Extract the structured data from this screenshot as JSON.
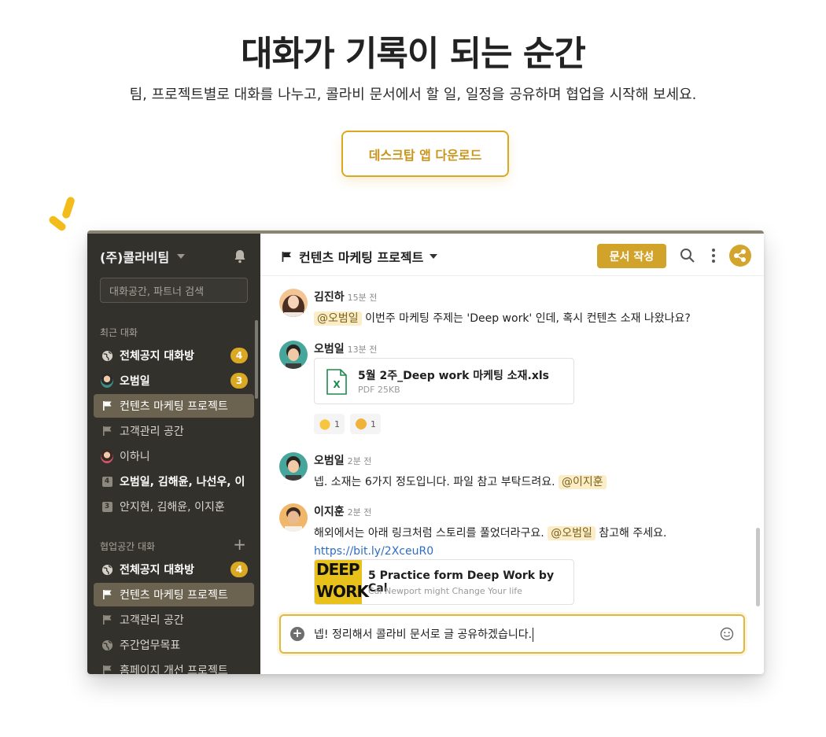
{
  "hero": {
    "title": "대화가 기록이 되는 순간",
    "subtitle": "팀, 프로젝트별로 대화를 나누고, 콜라비 문서에서 할 일, 일정을 공유하며 협업을 시작해 보세요.",
    "download_label": "데스크탑 앱 다운로드"
  },
  "colors": {
    "accent": "#dba823",
    "sidebar_bg": "#33312c",
    "mention_bg": "#fbedc6"
  },
  "sidebar": {
    "team_name": "(주)콜라비팀",
    "search_placeholder": "대화공간, 파트너 검색",
    "recent_label": "최근 대화",
    "recent": [
      {
        "icon": "globe-icon",
        "label": "전체공지 대화방",
        "badge": "4",
        "bold": true
      },
      {
        "icon": "avatar",
        "label": "오범일",
        "badge": "3",
        "bold": true
      },
      {
        "icon": "flag-icon",
        "label": "컨텐츠 마케팅 프로젝트",
        "active": true
      },
      {
        "icon": "flag-icon",
        "label": "고객관리 공간"
      },
      {
        "icon": "avatar",
        "label": "이하니"
      },
      {
        "icon": "group-count-icon",
        "count": "4",
        "label": "오범일, 김해윤, 나선우, 이",
        "bold": true
      },
      {
        "icon": "group-count-icon",
        "count": "3",
        "label": "안지현, 김해윤, 이지훈"
      }
    ],
    "collab_label": "협업공간 대화",
    "collab": [
      {
        "icon": "globe-icon",
        "label": "전체공지 대화방",
        "badge": "4",
        "bold": true
      },
      {
        "icon": "flag-icon",
        "label": "컨텐츠 마케팅 프로젝트",
        "active": true
      },
      {
        "icon": "flag-icon",
        "label": "고객관리 공간"
      },
      {
        "icon": "globe-icon",
        "label": "주간업무목표"
      },
      {
        "icon": "flag-icon",
        "label": "홈페이지 개선 프로젝트"
      }
    ]
  },
  "main": {
    "channel_title": "컨텐츠 마케팅 프로젝트",
    "write_doc_label": "문서 작성",
    "messages": [
      {
        "name": "김진하",
        "time": "15분 전",
        "mention": "@오범일",
        "text": "이번주 마케팅 주제는 'Deep work' 인데, 혹시 컨텐츠 소재 나왔나요?"
      },
      {
        "name": "오범일",
        "time": "13분 전",
        "file": {
          "name": "5월 2주_Deep work 마케팅 소재.xls",
          "meta": "PDF  25KB"
        },
        "reactions": [
          {
            "icon": "thumbs-up-icon",
            "count": "1"
          },
          {
            "icon": "star-eyes-icon",
            "count": "1"
          }
        ]
      },
      {
        "name": "오범일",
        "time": "2분 전",
        "text": "넵. 소재는 6가지 정도입니다. 파일 참고 부탁드려요.",
        "mention": "@이지훈"
      },
      {
        "name": "이지훈",
        "time": "2분 전",
        "text": "해외에서는 아래 링크처럼 스토리를 풀었더라구요.",
        "mention": "@오범일",
        "text_after": "참고해 주세요.",
        "link": "https://bit.ly/2XceuR0",
        "link_card": {
          "title": "5 Practice form Deep Work by Cal",
          "subtitle": "Cal Newport might Change Your life",
          "cover_top": "DEEP",
          "cover_bottom": "WORK"
        }
      }
    ],
    "composer_text": "넵! 정리해서 콜라비 문서로 글 공유하겠습니다."
  }
}
